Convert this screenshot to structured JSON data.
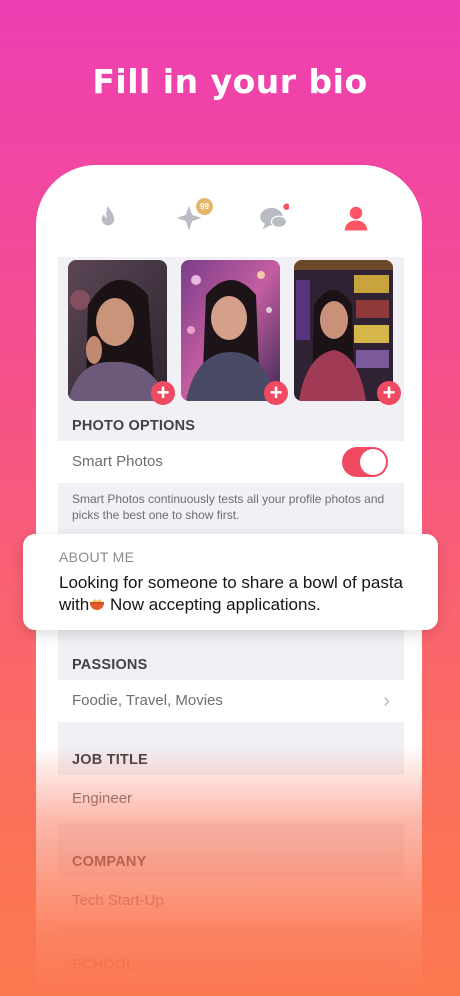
{
  "headline": "Fill in your bio",
  "nav": {
    "badge_count": "99",
    "icons": [
      "flame-icon",
      "sparkle-icon",
      "chat-icon",
      "profile-icon"
    ],
    "active_color": "#fd5564",
    "inactive_color": "#b9bcc4"
  },
  "photo_options": {
    "header": "PHOTO OPTIONS",
    "smart_photos_label": "Smart Photos",
    "smart_photos_enabled": true,
    "description": "Smart Photos continuously tests all your profile photos and picks the best one to show first."
  },
  "about": {
    "title": "ABOUT ME",
    "text_before": "Looking for someone to share a bowl of pasta with",
    "emoji": "pasta-bowl",
    "text_after": " Now accepting applications."
  },
  "passions": {
    "header": "PASSIONS",
    "value": "Foodie, Travel, Movies"
  },
  "job_title": {
    "header": "JOB TITLE",
    "value": "Engineer"
  },
  "company": {
    "header": "COMPANY",
    "value": "Tech Start-Up"
  },
  "school": {
    "header": "SCHOOL"
  },
  "accent_color": "#f04a63"
}
